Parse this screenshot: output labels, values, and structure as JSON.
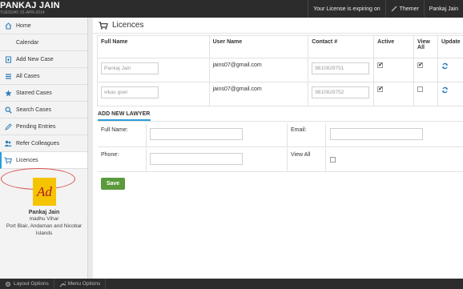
{
  "brand": {
    "name": "PANKAJ JAIN",
    "date": "TUESDAY, 01-APR-2014"
  },
  "topnav": {
    "license": "Your License is expiring on",
    "themer": "Themer",
    "user": "Pankaj Jain"
  },
  "sidebar": {
    "items": [
      {
        "label": "Home",
        "icon": "home-icon"
      },
      {
        "label": "Calendar",
        "icon": "calendar-icon"
      },
      {
        "label": "Add New Case",
        "icon": "add-document-icon"
      },
      {
        "label": "All Cases",
        "icon": "list-icon"
      },
      {
        "label": "Starred Cases",
        "icon": "star-icon"
      },
      {
        "label": "Search Cases",
        "icon": "search-icon"
      },
      {
        "label": "Pending Entries",
        "icon": "edit-icon"
      },
      {
        "label": "Refer Colleagues",
        "icon": "users-icon"
      },
      {
        "label": "Licences",
        "icon": "cart-icon",
        "active": true
      }
    ]
  },
  "profile": {
    "logo_text": "Ad",
    "name": "Pankaj Jain",
    "line1": "madhu Vihar",
    "line2": "Port Blair, Andaman and Nicobar",
    "line3": "Islands"
  },
  "page": {
    "title": "Licences"
  },
  "table": {
    "headers": [
      "Full Name",
      "User Name",
      "Contact #",
      "Active",
      "View All",
      "Update"
    ],
    "rows": [
      {
        "full_name": "Pankaj Jain",
        "user_name": "jains07@gmail.com",
        "contact": "9810829751",
        "active": true,
        "view_all": true
      },
      {
        "full_name": "vikas goel",
        "user_name": "jains07@gmail.com",
        "contact": "9810829752",
        "active": true,
        "view_all": false
      }
    ]
  },
  "add_lawyer": {
    "heading": "ADD NEW LAWYER",
    "full_name_label": "Full Name:",
    "email_label": "Email:",
    "phone_label": "Phone:",
    "view_all_label": "View All",
    "save_label": "Save"
  },
  "bottombar": {
    "layout_options": "Layout Options",
    "menu_options": "Menu Options"
  },
  "colors": {
    "topbar": "#2c2c2c",
    "accent": "#2c9ed8",
    "save": "#5a9a3c",
    "highlight_circle": "#d9534f",
    "logo_bg": "#f5c400",
    "logo_text": "#b0122a"
  }
}
